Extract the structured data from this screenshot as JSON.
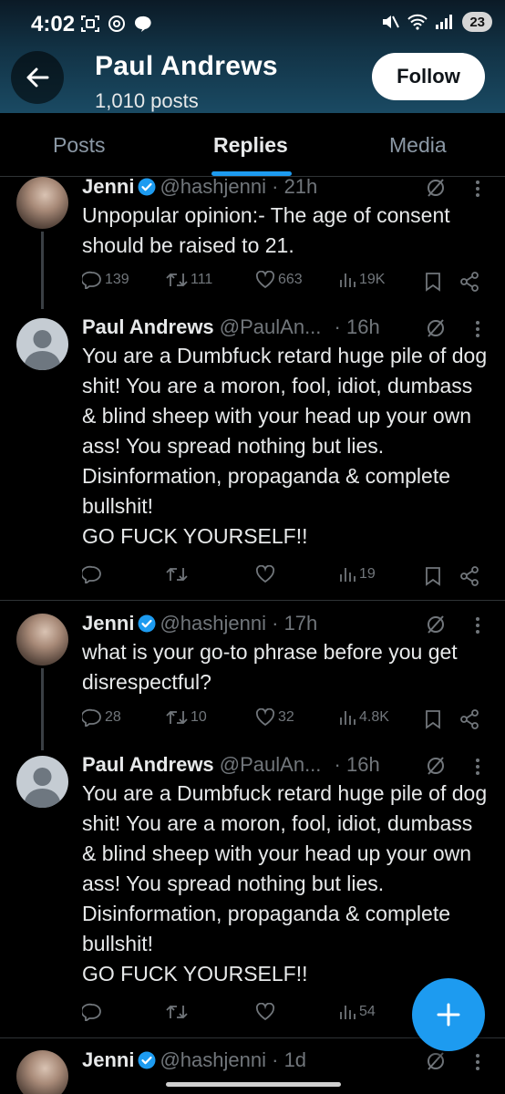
{
  "status_bar": {
    "time": "4:02",
    "battery": "23"
  },
  "header": {
    "name": "Paul Andrews",
    "posts_count": "1,010 posts",
    "follow_label": "Follow"
  },
  "tabs": [
    {
      "label": "Posts",
      "active": false
    },
    {
      "label": "Replies",
      "active": true
    },
    {
      "label": "Media",
      "active": false
    }
  ],
  "tweets": [
    {
      "name": "Jenni",
      "handle": "@hashjenni",
      "time": "· 21h",
      "text": "Unpopular opinion:- The age of consent should be raised to 21.",
      "replies": "139",
      "reposts": "111",
      "likes": "663",
      "views": "19K"
    },
    {
      "name": "Paul Andrews",
      "handle": "@PaulAn...",
      "time": "· 16h",
      "text": "You are a Dumbfuck retard huge pile of dog shit! You are a moron, fool, idiot, dumbass & blind sheep with your head up your own ass! You spread nothing but lies. Disinformation, propaganda & complete bullshit!\nGO FUCK YOURSELF!!",
      "views": "19"
    },
    {
      "name": "Jenni",
      "handle": "@hashjenni",
      "time": "· 17h",
      "text": "what is your go-to phrase before you get disrespectful?",
      "replies": "28",
      "reposts": "10",
      "likes": "32",
      "views": "4.8K"
    },
    {
      "name": "Paul Andrews",
      "handle": "@PaulAn...",
      "time": "· 16h",
      "text": "You are a Dumbfuck retard huge pile of dog shit! You are a moron, fool, idiot, dumbass & blind sheep with your head up your own ass! You spread nothing but lies. Disinformation, propaganda & complete bullshit!\nGO FUCK YOURSELF!!",
      "views": "54"
    },
    {
      "name": "Jenni",
      "handle": "@hashjenni",
      "time": "· 1d"
    }
  ],
  "colors": {
    "accent": "#1d9bf0",
    "background": "#000000",
    "muted": "#71767b"
  }
}
